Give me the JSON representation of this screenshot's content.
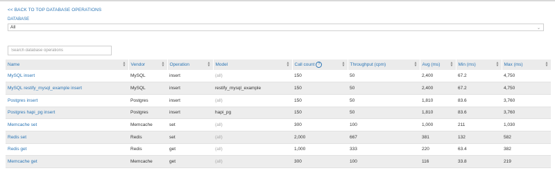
{
  "nav": {
    "back_label": "<< BACK TO TOP DATABASE OPERATIONS"
  },
  "filter": {
    "database_label": "DATABASE",
    "database_value": "All",
    "search_placeholder": "Search database operations"
  },
  "table": {
    "columns": [
      "Name",
      "Vendor",
      "Operation",
      "Model",
      "Call count",
      "Throughput (cpm)",
      "Avg (ms)",
      "Min (ms)",
      "Max (ms)"
    ],
    "rows": [
      {
        "name": "MySQL insert",
        "vendor": "MySQL",
        "operation": "insert",
        "model": "(all)",
        "calls": "150",
        "throughput": "50",
        "avg": "2,400",
        "min": "67.2",
        "max": "4,750"
      },
      {
        "name": "MySQL restify_mysql_example insert",
        "vendor": "MySQL",
        "operation": "insert",
        "model": "restify_mysql_example",
        "calls": "150",
        "throughput": "50",
        "avg": "2,400",
        "min": "67.2",
        "max": "4,750"
      },
      {
        "name": "Postgres insert",
        "vendor": "Postgres",
        "operation": "insert",
        "model": "(all)",
        "calls": "150",
        "throughput": "50",
        "avg": "1,810",
        "min": "83.6",
        "max": "3,760"
      },
      {
        "name": "Postgres hapi_pg insert",
        "vendor": "Postgres",
        "operation": "insert",
        "model": "hapi_pg",
        "calls": "150",
        "throughput": "50",
        "avg": "1,810",
        "min": "83.6",
        "max": "3,760"
      },
      {
        "name": "Memcache set",
        "vendor": "Memcache",
        "operation": "set",
        "model": "(all)",
        "calls": "300",
        "throughput": "100",
        "avg": "1,000",
        "min": "211",
        "max": "1,030"
      },
      {
        "name": "Redis set",
        "vendor": "Redis",
        "operation": "set",
        "model": "(all)",
        "calls": "2,000",
        "throughput": "667",
        "avg": "381",
        "min": "132",
        "max": "582"
      },
      {
        "name": "Redis get",
        "vendor": "Redis",
        "operation": "get",
        "model": "(all)",
        "calls": "1,000",
        "throughput": "333",
        "avg": "220",
        "min": "63.4",
        "max": "382"
      },
      {
        "name": "Memcache get",
        "vendor": "Memcache",
        "operation": "get",
        "model": "(all)",
        "calls": "300",
        "throughput": "100",
        "avg": "116",
        "min": "33.8",
        "max": "219"
      }
    ]
  },
  "icons": {
    "help": "question-circle-icon",
    "sort": "sort-arrows-icon",
    "dropdown": "chevron-down-icon"
  },
  "colors": {
    "link": "#2b75b5",
    "alt_row": "#ededed",
    "header_bg": "#ebebeb"
  }
}
